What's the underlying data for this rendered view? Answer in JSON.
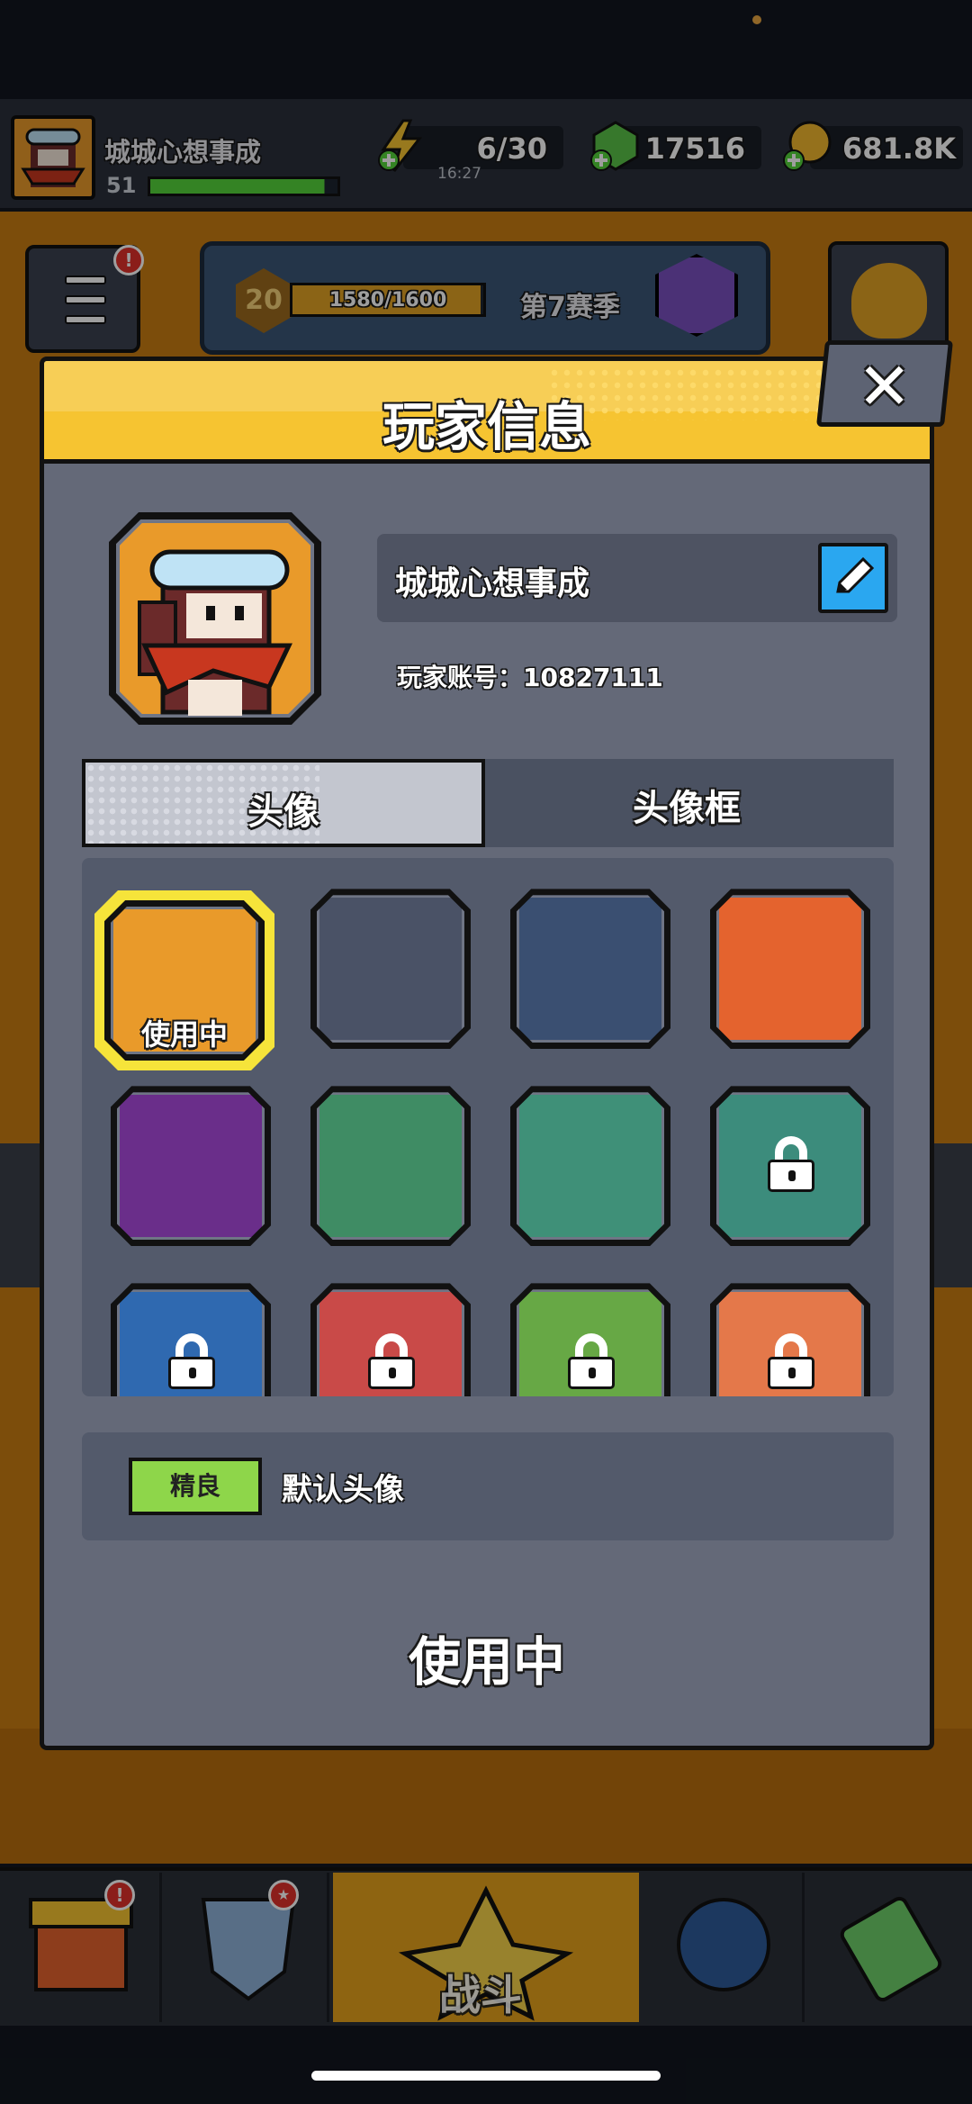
{
  "player": {
    "name": "城城心想事成",
    "level": "51",
    "xp_fraction": 0.93
  },
  "resources": {
    "energy": "6/30",
    "energy_timer": "16:27",
    "gems": "17516",
    "coins": "681.8K"
  },
  "season": {
    "level": "20",
    "xp": "1580/1600",
    "xp_fraction": 0.9875,
    "name": "第7赛季"
  },
  "badges": {
    "menu": "!",
    "shop": "!",
    "equipment": "★"
  },
  "nav": {
    "fight_label": "战斗"
  },
  "modal": {
    "title": "玩家信息",
    "close_label": "✕",
    "profile_name": "城城心想事成",
    "account_label": "玩家账号：",
    "account_id": "10827111",
    "tabs": [
      {
        "label": "头像",
        "active": true
      },
      {
        "label": "头像框",
        "active": false
      }
    ],
    "avatars": [
      {
        "name": "masked-bandit-avatar",
        "locked": false,
        "selected": true,
        "bg": "#e99a2a",
        "selected_label": "使用中"
      },
      {
        "name": "zombie-agent-avatar",
        "locked": false,
        "bg": "#4a5266"
      },
      {
        "name": "boar-monster-avatar",
        "locked": false,
        "bg": "#3a4f71"
      },
      {
        "name": "zombie-soldier-avatar",
        "locked": false,
        "bg": "#e4632e"
      },
      {
        "name": "purple-crab-avatar",
        "locked": false,
        "bg": "#6a2e8a"
      },
      {
        "name": "tentacle-monster-avatar",
        "locked": false,
        "bg": "#3f8c64"
      },
      {
        "name": "flower-frog-avatar",
        "locked": false,
        "bg": "#3f9078"
      },
      {
        "name": "pirate-ship-avatar",
        "locked": true,
        "bg": "#3c8c7c"
      },
      {
        "name": "pirate-captain-avatar",
        "locked": true,
        "bg": "#2f69b0"
      },
      {
        "name": "red-hood-avatar",
        "locked": true,
        "bg": "#c94a48"
      },
      {
        "name": "cat-avatar",
        "locked": true,
        "bg": "#67a845"
      },
      {
        "name": "bandana-avatar",
        "locked": true,
        "bg": "#e4784a"
      }
    ],
    "rarity": "精良",
    "avatar_name": "默认头像",
    "status": "使用中"
  },
  "colors": {
    "header_yellow": "#f6c431",
    "modal_bg": "#646978",
    "rarity_green": "#8ed64a",
    "selected_frame": "#f6e43a",
    "edit_button": "#2aa7f0"
  }
}
